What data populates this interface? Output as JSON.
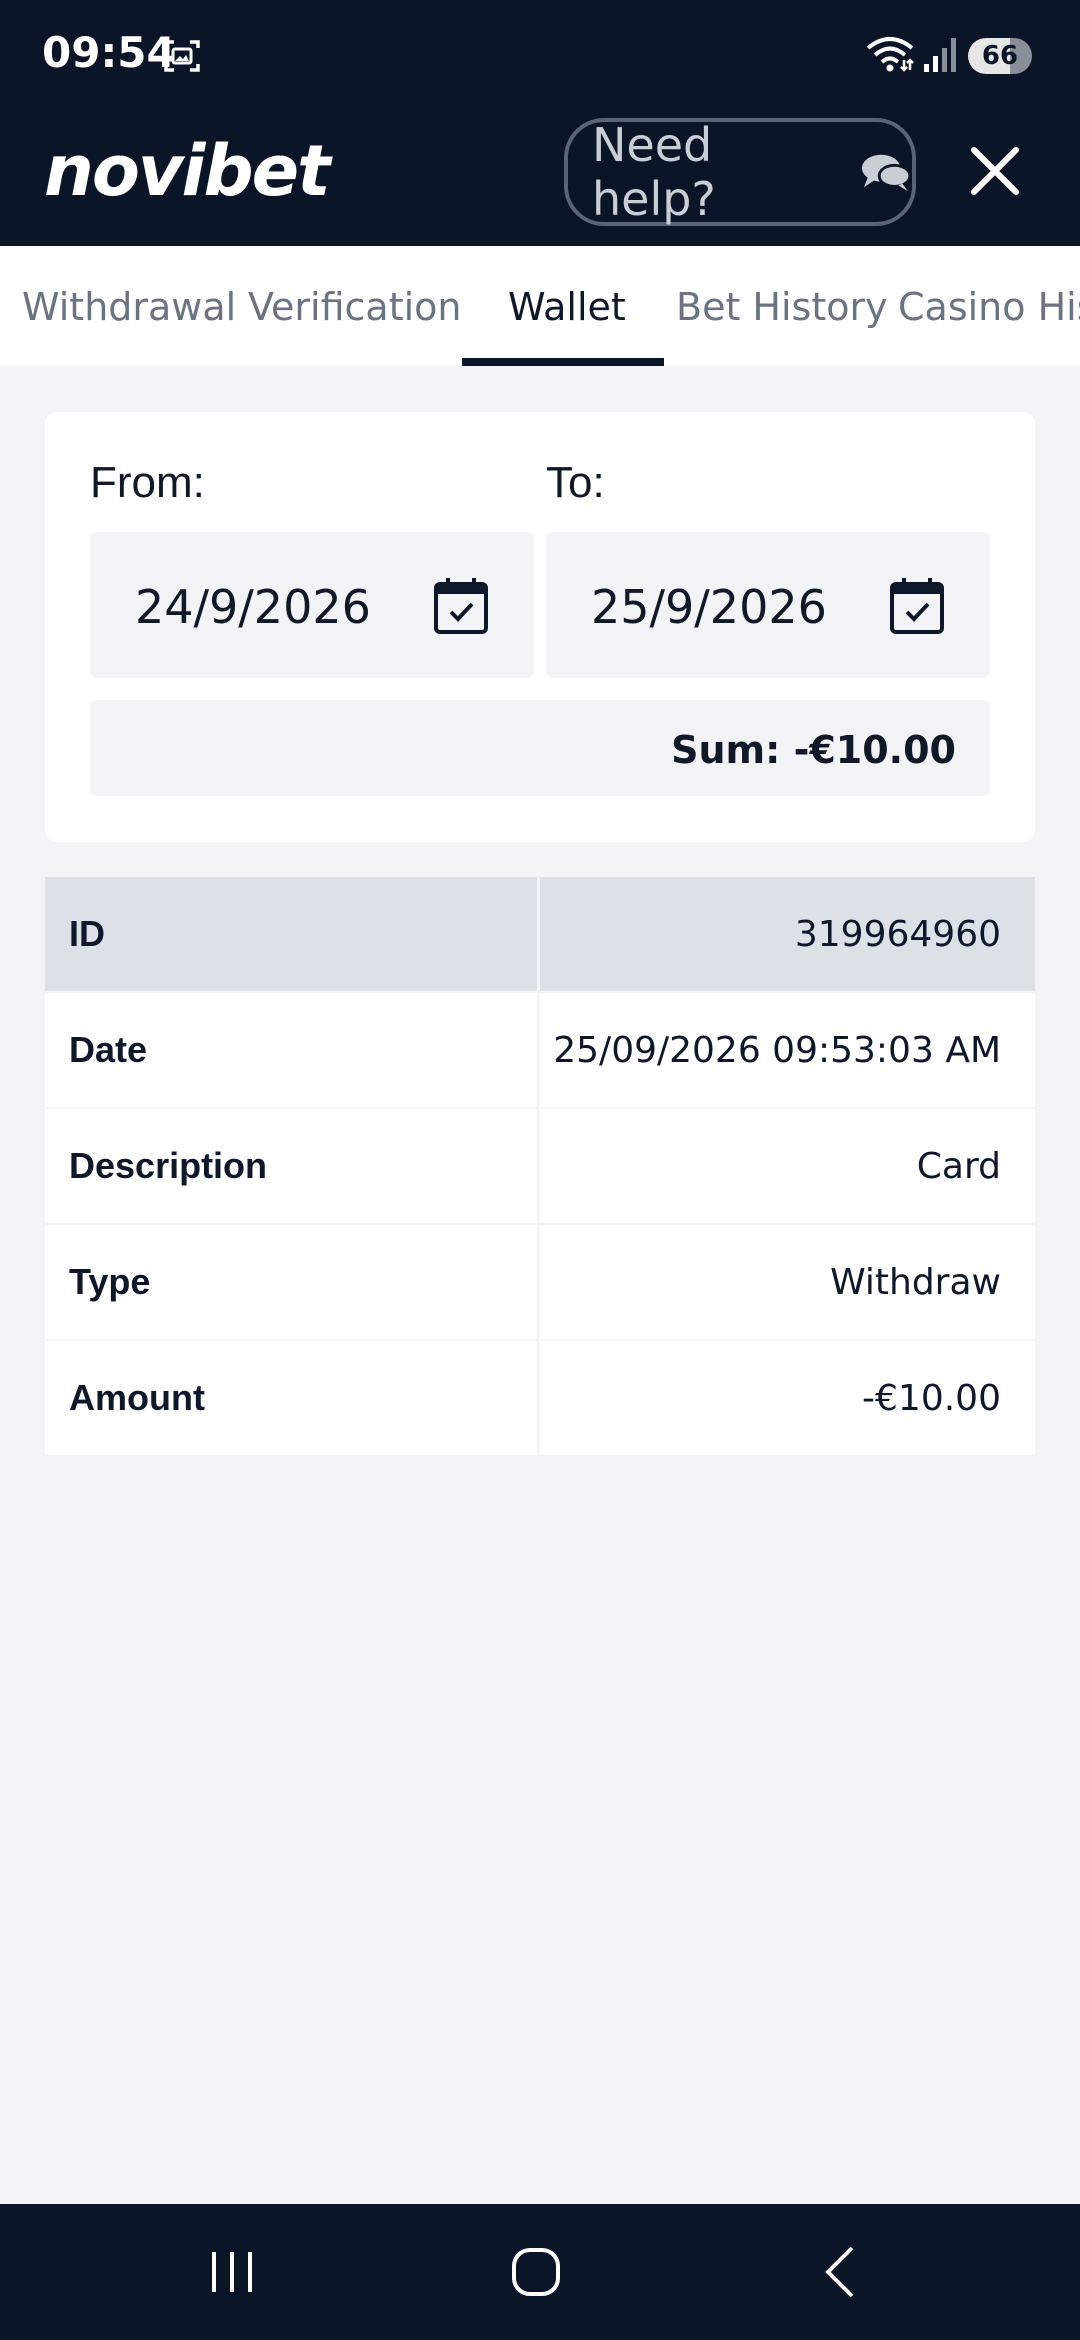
{
  "status_bar": {
    "time": "09:54",
    "battery": "66"
  },
  "header": {
    "logo": "novibet",
    "help_label": "Need help?"
  },
  "tabs": [
    {
      "label": "Withdrawal"
    },
    {
      "label": "Verification"
    },
    {
      "label": "Wallet"
    },
    {
      "label": "Bet History"
    },
    {
      "label": "Casino His"
    }
  ],
  "active_tab": "Wallet",
  "filter": {
    "from_label": "From:",
    "from_value": "24/9/2026",
    "to_label": "To:",
    "to_value": "25/9/2026",
    "sum": "Sum: -€10.00"
  },
  "details": [
    {
      "label": "ID",
      "value": "319964960"
    },
    {
      "label": "Date",
      "value": "25/09/2026 09:53:03 AM"
    },
    {
      "label": "Description",
      "value": "Card"
    },
    {
      "label": "Type",
      "value": "Withdraw"
    },
    {
      "label": "Amount",
      "value": "-€10.00"
    }
  ],
  "colors": {
    "dark_navy": "#0c1428",
    "page_bg": "#f3f4f6",
    "table_header_bg": "#dce1e8"
  },
  "icons": [
    "screenshot-icon",
    "wifi-icon",
    "signal-icon",
    "chat-icon",
    "close-icon",
    "calendar-icon",
    "recents-icon",
    "home-icon",
    "back-icon"
  ]
}
